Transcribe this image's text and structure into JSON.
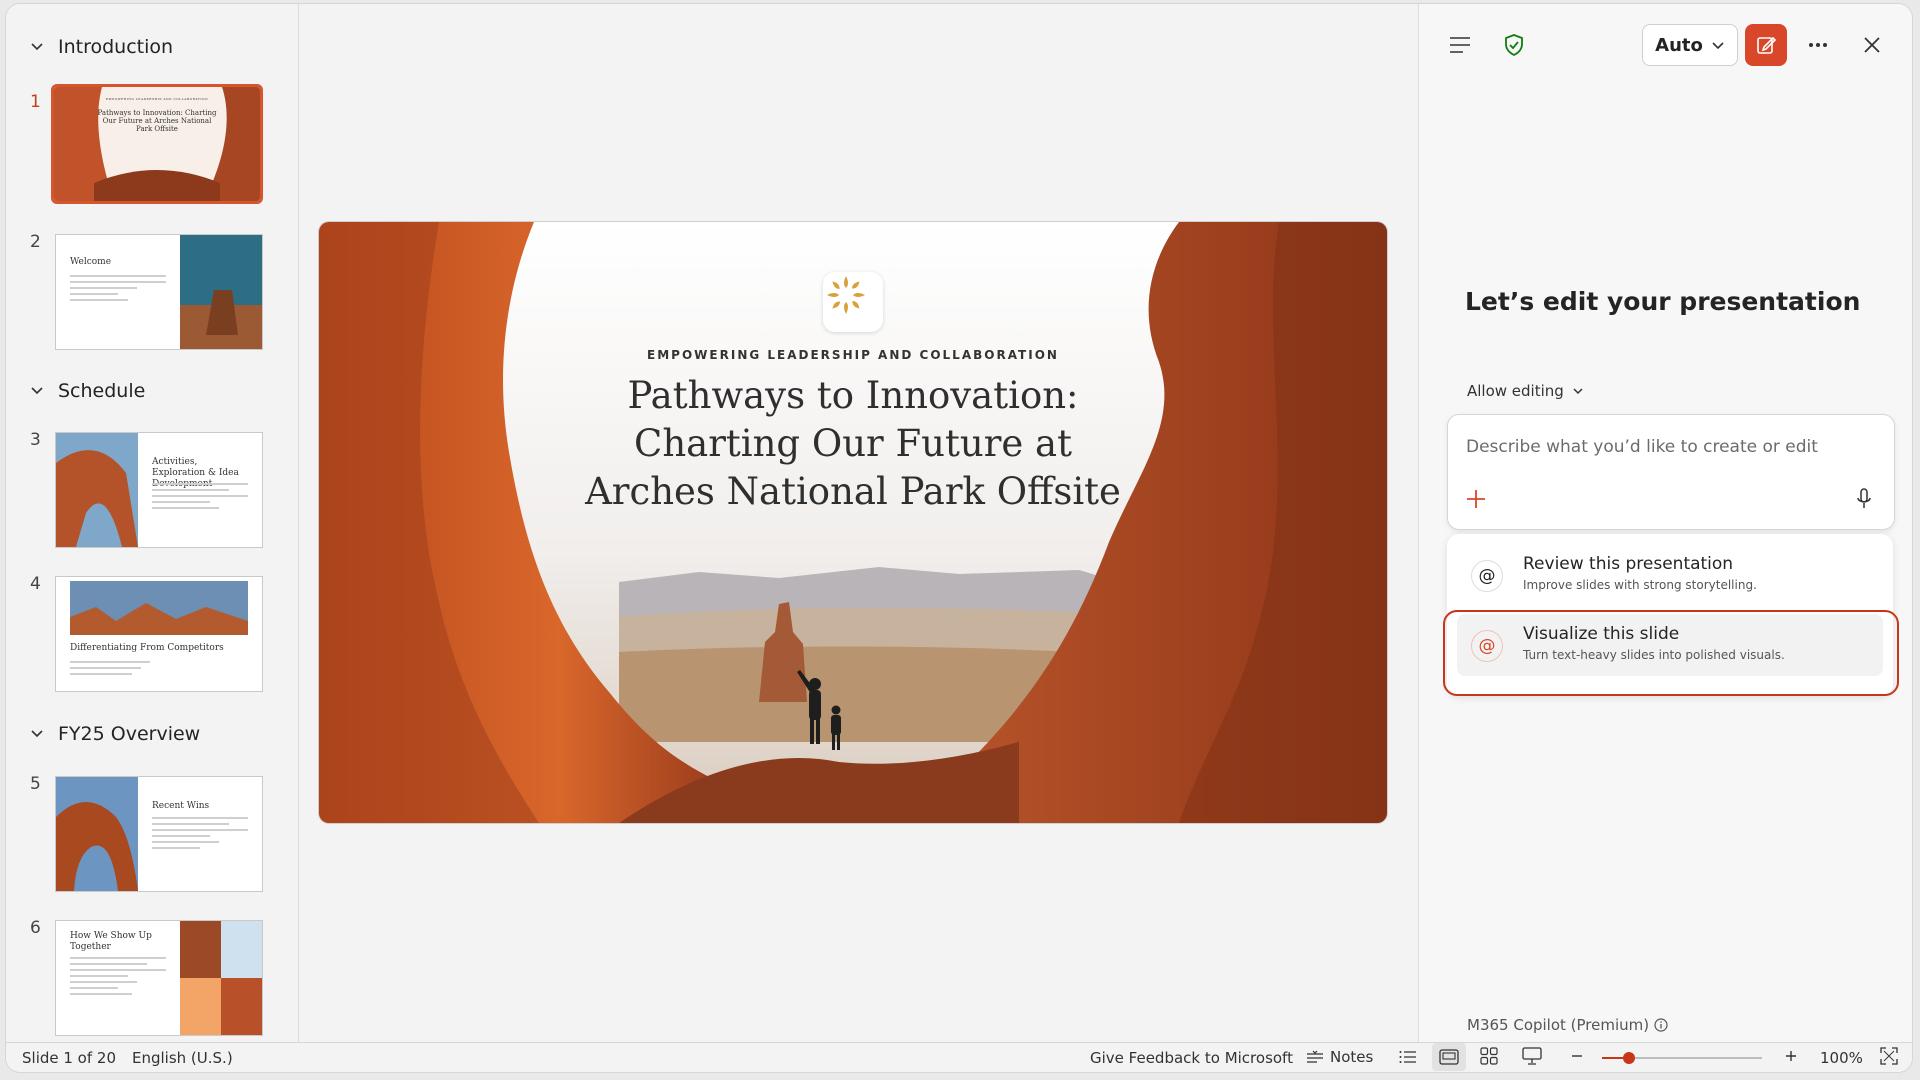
{
  "thumbnails": {
    "sections": [
      "Introduction",
      "Schedule",
      "FY25 Overview"
    ],
    "slides": [
      {
        "number": "1",
        "eyebrow": "EMPOWERING LEADERSHIP AND COLLABORATION",
        "title": "Pathways to Innovation: Charting Our Future at Arches National Park Offsite"
      },
      {
        "number": "2",
        "title": "Welcome"
      },
      {
        "number": "3",
        "title": "Activities, Exploration & Idea Development"
      },
      {
        "number": "4",
        "title": "Differentiating From Competitors"
      },
      {
        "number": "5",
        "title": "Recent Wins"
      },
      {
        "number": "6",
        "title": "How We Show Up Together"
      }
    ]
  },
  "slide": {
    "eyebrow": "EMPOWERING LEADERSHIP AND COLLABORATION",
    "title_line1": "Pathways to Innovation:",
    "title_line2": "Charting Our Future at",
    "title_line3": "Arches National Park Offsite"
  },
  "copilot": {
    "mode_label": "Auto",
    "heading": "Let’s edit your presentation",
    "allow_label": "Allow editing",
    "prompt_placeholder": "Describe what you’d like to create or edit",
    "suggestions": [
      {
        "title": "Review this presentation",
        "subtitle": "Improve slides with strong storytelling."
      },
      {
        "title": "Visualize this slide",
        "subtitle": "Turn text-heavy slides into polished visuals."
      }
    ],
    "premium_label": "M365 Copilot (Premium)"
  },
  "status_bar": {
    "slide_counter": "Slide 1 of 20",
    "language": "English (U.S.)",
    "feedback": "Give Feedback to Microsoft",
    "notes": "Notes",
    "zoom": "100%",
    "zoom_level": 0.17
  },
  "colors": {
    "accent": "#d9472a",
    "highlight": "#c8361a",
    "shield": "#107c10"
  },
  "icons": [
    "chevron-down-icon",
    "menu-icon",
    "shield-check-icon",
    "edit-icon",
    "more-icon",
    "close-icon",
    "plus-icon",
    "microphone-icon",
    "at-icon",
    "info-icon",
    "notes-icon",
    "outline-view-icon",
    "normal-view-icon",
    "grid-view-icon",
    "presenter-view-icon",
    "zoom-out-icon",
    "zoom-in-icon",
    "fit-icon"
  ]
}
